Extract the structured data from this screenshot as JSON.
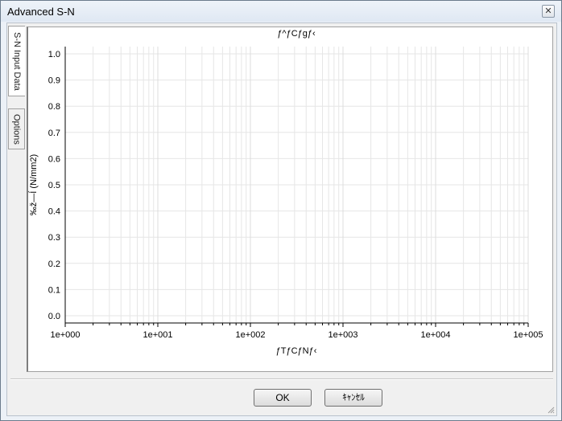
{
  "window": {
    "title": "Advanced S-N",
    "close_glyph": "✕"
  },
  "tabs": [
    {
      "label": "S-N Input Data",
      "selected": true
    },
    {
      "label": "Options",
      "selected": false
    }
  ],
  "chart_data": {
    "type": "line",
    "title": "ƒ^ƒCƒgƒ‹",
    "xlabel": "ƒTƒCƒNƒ‹",
    "ylabel": "‰ž—Í (N/mm2)",
    "x_scale": "log",
    "xlim": [
      1,
      100000
    ],
    "ylim": [
      0.0,
      1.0
    ],
    "x_tick_labels": [
      "1e+000",
      "1e+001",
      "1e+002",
      "1e+003",
      "1e+004",
      "1e+005"
    ],
    "y_tick_labels": [
      "1.0",
      "0.9",
      "0.8",
      "0.7",
      "0.6",
      "0.5",
      "0.4",
      "0.3",
      "0.2",
      "0.1",
      "0.0"
    ],
    "grid": true,
    "series": []
  },
  "buttons": {
    "ok": "OK",
    "cancel": "ｷｬﾝｾﾙ"
  }
}
